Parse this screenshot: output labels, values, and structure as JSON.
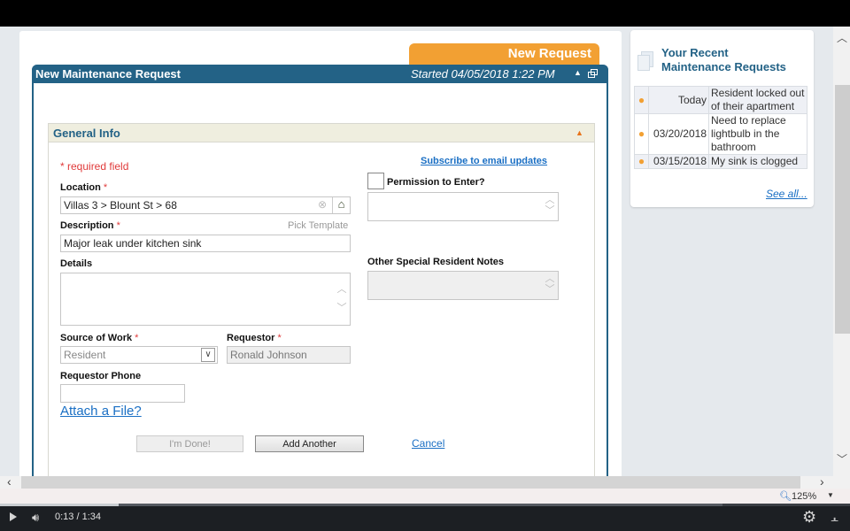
{
  "new_request_tab": "New Request",
  "panel": {
    "title": "New Maintenance Request",
    "started": "Started 04/05/2018 1:22 PM",
    "collapse_icon": "▲",
    "popout_icon": "popout-icon"
  },
  "section": {
    "title": "General Info",
    "collapse_icon": "▲"
  },
  "form": {
    "required_note": "* required field",
    "subscribe_link": "Subscribe to email updates",
    "location": {
      "label": "Location",
      "required": "*",
      "value": "Villas 3 > Blount St > 68"
    },
    "description": {
      "label": "Description",
      "required": "*",
      "value": "Major leak under kitchen sink",
      "pick_template": "Pick Template"
    },
    "details": {
      "label": "Details",
      "value": ""
    },
    "permission": {
      "label": "Permission to Enter?",
      "checked": false,
      "value": ""
    },
    "resident_notes": {
      "label": "Other Special Resident Notes",
      "value": ""
    },
    "source_of_work": {
      "label": "Source of Work",
      "required": "*",
      "value": "Resident"
    },
    "requestor": {
      "label": "Requestor",
      "required": "*",
      "value": "Ronald Johnson"
    },
    "requestor_phone": {
      "label": "Requestor Phone",
      "value": ""
    },
    "attach_link": "Attach a File?",
    "buttons": {
      "done": "I'm Done!",
      "add_another": "Add Another",
      "cancel": "Cancel"
    }
  },
  "recent": {
    "title_line1": "Your Recent",
    "title_line2": "Maintenance Requests",
    "items": [
      {
        "status": "●",
        "date": "Today",
        "text": "Resident locked out of their apartment"
      },
      {
        "status": "●",
        "date": "03/20/2018",
        "text": "Need to replace lightbulb in the bathroom"
      },
      {
        "status": "●",
        "date": "03/15/2018",
        "text": "My sink is clogged"
      }
    ],
    "see_all": "See all..."
  },
  "browser": {
    "zoom_level": "125%"
  },
  "video": {
    "time": "0:13 / 1:34",
    "progress": 0.14,
    "buffered": 0.85
  },
  "colors": {
    "primary": "#236286",
    "accent": "#f2a033",
    "required": "#e03a3a",
    "link": "#1a6fc4"
  }
}
